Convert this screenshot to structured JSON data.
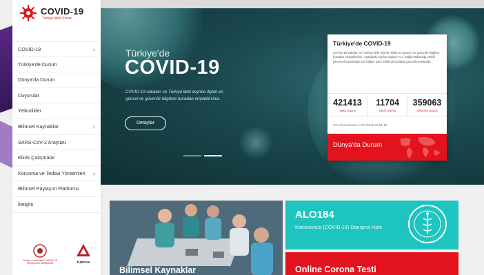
{
  "brand": {
    "title": "COVID-19",
    "subtitle": "Türkiye Web Portalı",
    "accent": "#e2131c",
    "teal": "#1ec4bf"
  },
  "sidebar": {
    "items": [
      {
        "label": "COVID-19",
        "has_submenu": true
      },
      {
        "label": "Türkiye'de Durum",
        "has_submenu": false
      },
      {
        "label": "Dünya'da Durum",
        "has_submenu": false
      },
      {
        "label": "Duyurular",
        "has_submenu": false
      },
      {
        "label": "Yetkinlikler",
        "has_submenu": false
      },
      {
        "label": "Bilimsel Kaynaklar",
        "has_submenu": true
      },
      {
        "label": "SARS-CoV-2 Arayüzü",
        "has_submenu": false
      },
      {
        "label": "Klinik Çalışmalar",
        "has_submenu": false
      },
      {
        "label": "Korunma ve Tedavi Yöntemleri",
        "has_submenu": true
      },
      {
        "label": "Bilimsel Paylaşım Platformu",
        "has_submenu": false
      },
      {
        "label": "İletişim",
        "has_submenu": false
      }
    ],
    "chevron": "›",
    "partners": {
      "left_text": "Türkiye Cumhuriyeti SANAYİ VE TEKNOLOJİ BAKANLIĞI",
      "right_text": "TÜBİTAK"
    }
  },
  "hero": {
    "subtitle": "Türkiye'de",
    "title": "COVID-19",
    "description": "COVID-19 vakaları ve Türkiye'deki seyrine ilişkin en güncel ve güvenilir bilgilere buradan erişebilirsiniz.",
    "button": "Detaylar",
    "slides": 2,
    "active_slide": 2
  },
  "stats_card": {
    "title": "Türkiye'de COVID-19",
    "text": "COVID-19 vakaları ve Türkiye'deki seyrine ilişkin en güncel ve güvenilir bilgilere buradan erişebilirsiniz. Aşağıdaki sayılar sadece T.C. Sağlık Bakanlığı yetkili personeli tarafından veri bilgiye göre belirli periyotlarla güncellenmektedir.",
    "stats": [
      {
        "value": "421413",
        "label": "Vaka Sayısı"
      },
      {
        "value": "11704",
        "label": "Ölüm Sayısı"
      },
      {
        "value": "359063",
        "label": "İyileşme Sayısı"
      }
    ],
    "updated": "Son Güncelleme: 17/11/2020 23:51:18",
    "world_button": "Dünya'da Durum"
  },
  "tiles": {
    "science": "Bilimsel Kaynaklar",
    "alo_title": "ALO184",
    "alo_sub": "Koronavirüs (COVID-19) Danışma Hattı",
    "test": "Online Corona Testi"
  }
}
